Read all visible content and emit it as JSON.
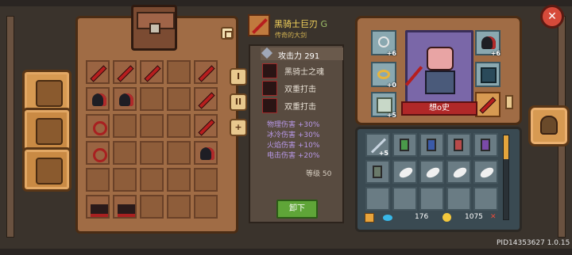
{
  "item": {
    "name": "黑骑士巨刃",
    "grade": "G",
    "rarity": "传奇的大剑",
    "attack_label": "攻击力",
    "attack_value": "291",
    "skills": [
      "黑骑士之魂",
      "双重打击",
      "双重打击"
    ],
    "stats": [
      "物理伤害 +30%",
      "冰冷伤害 +30%",
      "火焰伤害 +10%",
      "电击伤害 +20%"
    ],
    "level_label": "等级",
    "level_value": "50",
    "unequip_label": "卸下"
  },
  "inventory_tabs": [
    "I",
    "II",
    "+"
  ],
  "character": {
    "name": "想o史",
    "slot_badges": [
      "+6",
      "+0",
      "+5",
      "+6"
    ]
  },
  "bag": {
    "first_badge": "+5"
  },
  "currency": {
    "gems": "176",
    "coins": "1075"
  },
  "footer": {
    "pid": "PID14353627 1.0.15"
  },
  "colors": {
    "gold_text": "#f4d35c",
    "stat_text": "#b898e8",
    "unequip_green": "#5fa538"
  }
}
